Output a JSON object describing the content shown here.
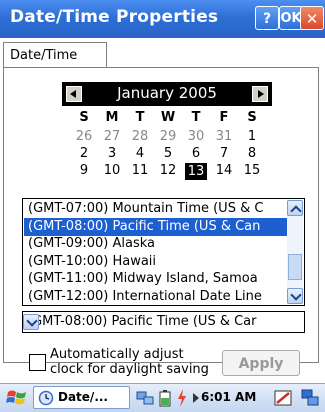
{
  "window": {
    "title": "Date/Time Properties",
    "help_label": "?",
    "ok_label": "OK",
    "close_label": "✕"
  },
  "tabs": [
    {
      "label": "Date/Time"
    }
  ],
  "calendar": {
    "month_label": "January 2005",
    "weekdays": [
      "S",
      "M",
      "T",
      "W",
      "T",
      "F",
      "S"
    ],
    "rows": [
      [
        {
          "d": "26",
          "g": true
        },
        {
          "d": "27",
          "g": true
        },
        {
          "d": "28",
          "g": true
        },
        {
          "d": "29",
          "g": true
        },
        {
          "d": "30",
          "g": true
        },
        {
          "d": "31",
          "g": true
        },
        {
          "d": "1"
        }
      ],
      [
        {
          "d": "2"
        },
        {
          "d": "3"
        },
        {
          "d": "4"
        },
        {
          "d": "5"
        },
        {
          "d": "6"
        },
        {
          "d": "7"
        },
        {
          "d": "8"
        }
      ],
      [
        {
          "d": "9"
        },
        {
          "d": "10"
        },
        {
          "d": "11"
        },
        {
          "d": "12"
        },
        {
          "d": "13",
          "sel": true
        },
        {
          "d": "14"
        },
        {
          "d": "15"
        }
      ]
    ]
  },
  "timezone_list": {
    "items": [
      "(GMT-07:00) Mountain Time (US & C",
      "(GMT-08:00) Pacific Time (US & Can",
      "(GMT-09:00) Alaska",
      "(GMT-10:00) Hawaii",
      "(GMT-11:00) Midway Island, Samoa",
      "(GMT-12:00) International Date Line"
    ],
    "selected_index": 1
  },
  "timezone_combo": {
    "value": "(GMT-08:00) Pacific Time (US & Car"
  },
  "daylight": {
    "line1": "Automatically adjust",
    "line2": "clock for daylight saving",
    "checked": false
  },
  "apply_label": "Apply",
  "taskbar": {
    "app_label": "Date/...",
    "clock": "6:01 AM"
  },
  "colors": {
    "title_bar": "#2d6fd6",
    "selection": "#1c5fd1",
    "close_button": "#d8492a"
  }
}
